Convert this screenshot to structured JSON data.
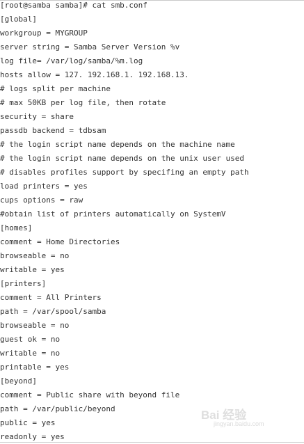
{
  "terminal": {
    "lines": [
      "[root@samba samba]# cat smb.conf",
      "[global]",
      "workgroup = MYGROUP",
      "server string = Samba Server Version %v",
      "log file= /var/log/samba/%m.log",
      "hosts allow = 127. 192.168.1. 192.168.13.",
      "# logs split per machine",
      "# max 50KB per log file, then rotate",
      "security = share",
      "passdb backend = tdbsam",
      "# the login script name depends on the machine name",
      "# the login script name depends on the unix user used",
      "# disables profiles support by specifing an empty path",
      "load printers = yes",
      "cups options = raw",
      "#obtain list of printers automatically on SystemV",
      "[homes]",
      "comment = Home Directories",
      "browseable = no",
      "writable = yes",
      "[printers]",
      "comment = All Printers",
      "path = /var/spool/samba",
      "browseable = no",
      "guest ok = no",
      "writable = no",
      "printable = yes",
      "[beyond]",
      "comment = Public share with beyond file",
      "path = /var/public/beyond",
      "public = yes",
      "readonly = yes"
    ]
  },
  "watermark": {
    "brand": "Bai 经验",
    "url": "jingyan.baidu.com"
  }
}
